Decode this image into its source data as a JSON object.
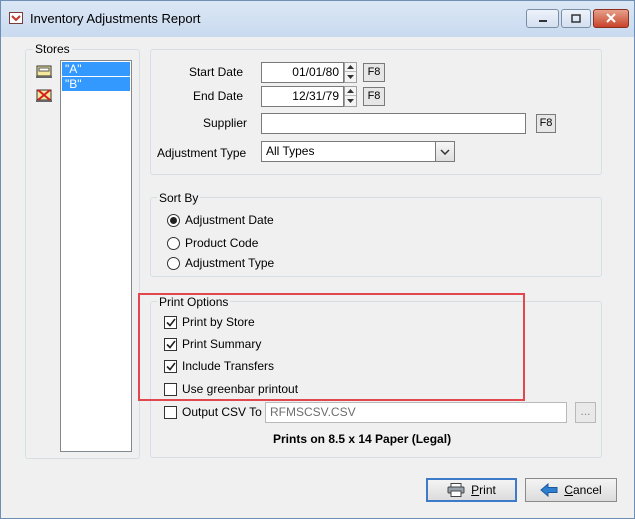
{
  "window": {
    "title": "Inventory Adjustments Report"
  },
  "stores": {
    "legend": "Stores",
    "items": [
      {
        "label": "\"A\"",
        "icon": "store-open-icon"
      },
      {
        "label": "\"B\"",
        "icon": "store-closed-icon"
      }
    ]
  },
  "filters": {
    "start_date_label": "Start Date",
    "start_date": "01/01/80",
    "end_date_label": "End Date",
    "end_date": "12/31/79",
    "supplier_label": "Supplier",
    "supplier_value": "",
    "lookup_label": "F8",
    "adjustment_type_label": "Adjustment Type",
    "adjustment_type_value": "All Types"
  },
  "sort_by": {
    "legend": "Sort By",
    "options": [
      {
        "label": "Adjustment Date",
        "selected": true
      },
      {
        "label": "Product Code",
        "selected": false
      },
      {
        "label": "Adjustment Type",
        "selected": false
      }
    ]
  },
  "print_options": {
    "legend": "Print Options",
    "options": [
      {
        "label": "Print by Store",
        "checked": true
      },
      {
        "label": "Print Summary",
        "checked": true
      },
      {
        "label": "Include Transfers",
        "checked": true
      },
      {
        "label": "Use greenbar printout",
        "checked": false
      }
    ],
    "csv_label": "Output CSV To",
    "csv_checked": false,
    "csv_path": "RFMSCSV.CSV",
    "browse_label": "...",
    "paper_note": "Prints on 8.5 x 14 Paper (Legal)"
  },
  "buttons": {
    "print_first": "P",
    "print_rest": "rint",
    "cancel_first": "C",
    "cancel_rest": "ancel"
  },
  "colors": {
    "selection": "#3399ff",
    "highlight_box": "#e0484e",
    "default_button_border": "#3d7bc9"
  }
}
